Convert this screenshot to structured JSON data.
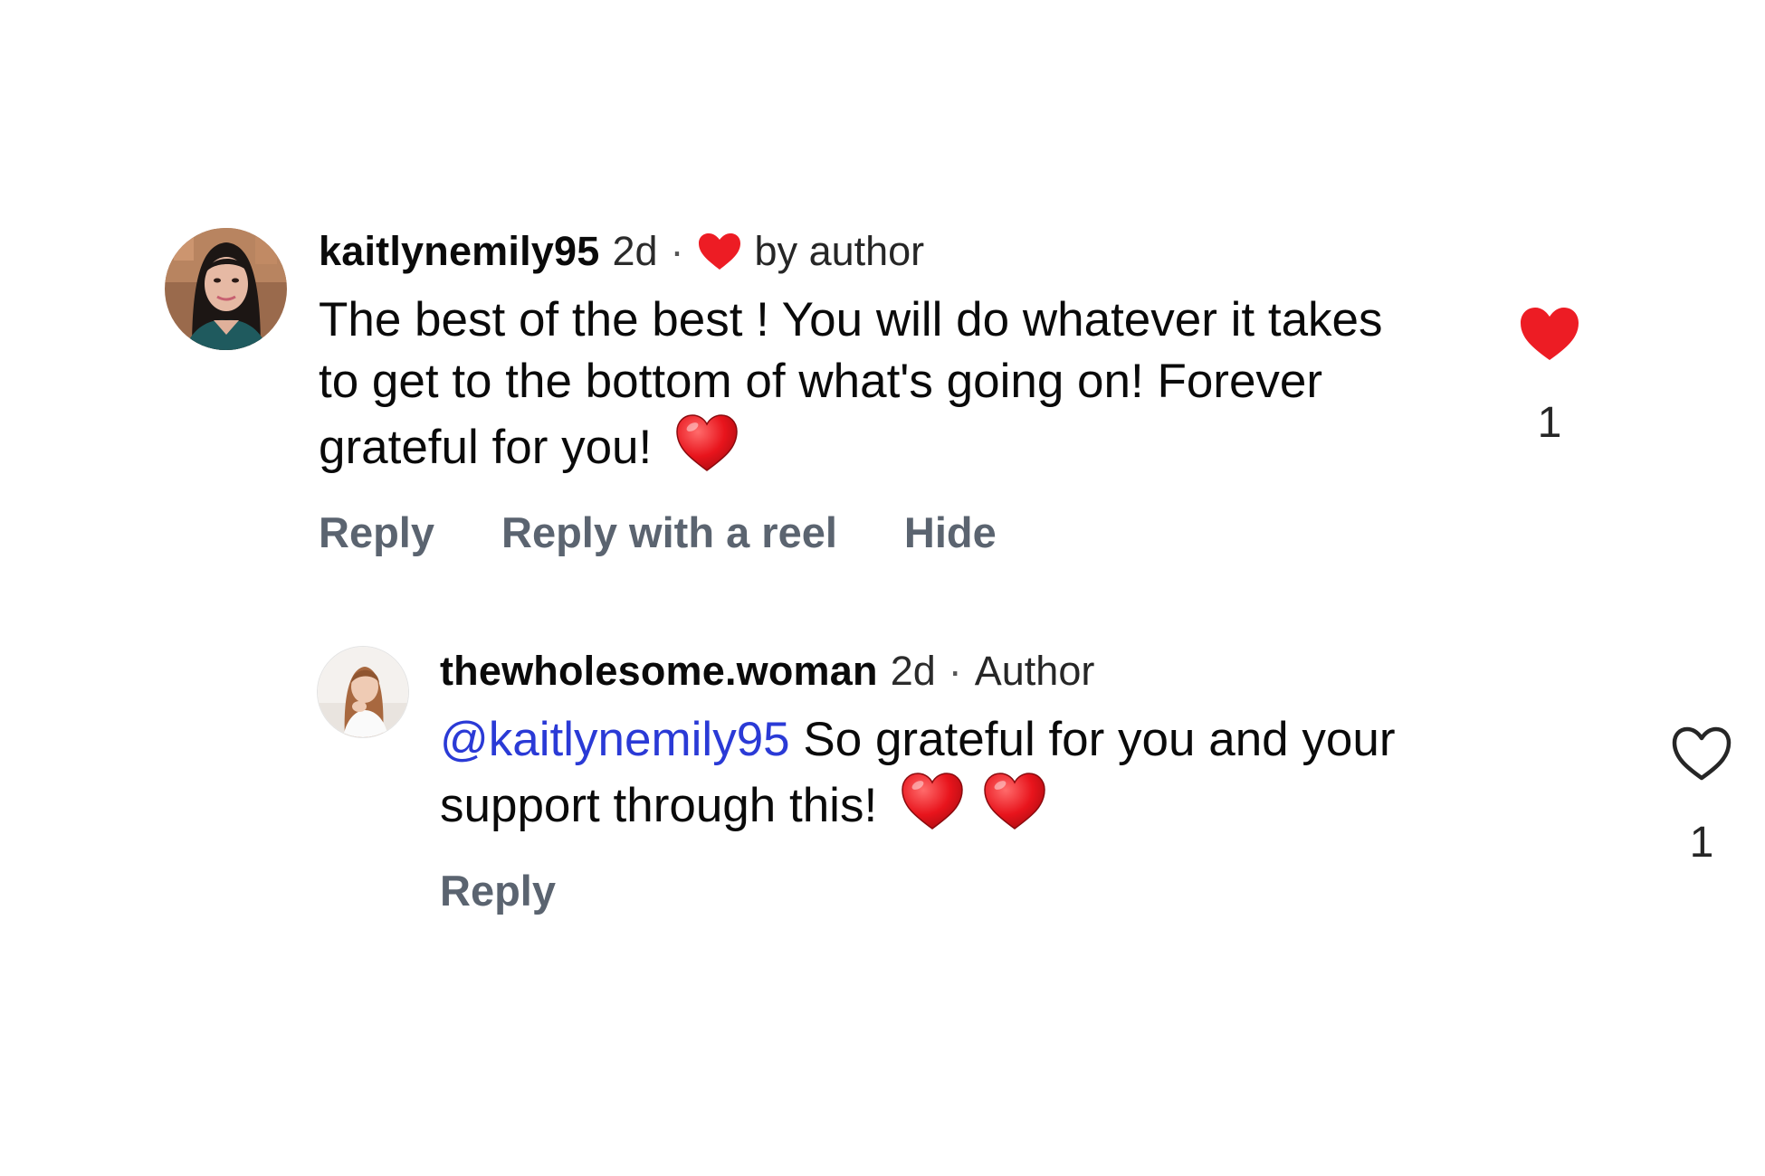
{
  "comments": [
    {
      "username": "kaitlynemily95",
      "time": "2d",
      "separator": "·",
      "liked_by_label": "by author",
      "text": "The best of the best ! You will do whatever it takes to get to the bottom of what's going on! Forever grateful for you!",
      "emoji": "red-heart",
      "actions": [
        "Reply",
        "Reply with a reel",
        "Hide"
      ],
      "like_state": "liked",
      "like_count": "1"
    }
  ],
  "replies": [
    {
      "username": "thewholesome.woman",
      "time": "2d",
      "separator": "·",
      "author_label": "Author",
      "mention": "@kaitlynemily95",
      "text": "So grateful for you and your support through this!",
      "emoji": [
        "red-heart",
        "red-heart"
      ],
      "actions": [
        "Reply"
      ],
      "like_state": "not-liked",
      "like_count": "1"
    }
  ],
  "colors": {
    "heart_red": "#ed1c24",
    "mention_blue": "#2a3ad6",
    "action_gray": "#5b6470"
  },
  "icons": {
    "liked_by_author": "filled-heart-icon",
    "like_filled": "filled-heart-icon",
    "like_outline": "outline-heart-icon"
  }
}
